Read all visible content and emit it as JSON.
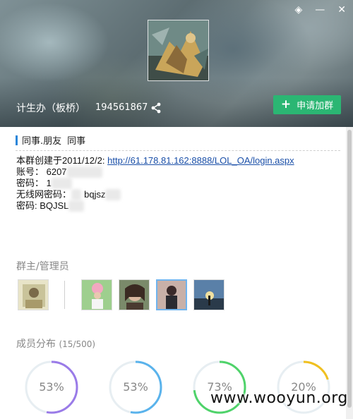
{
  "window": {
    "controls": [
      "◈",
      "—",
      "✕"
    ]
  },
  "header": {
    "group_name": "计生办（板桥）",
    "group_id": "194561867",
    "join_button": "申请加群"
  },
  "tags": [
    "同事.朋友",
    "同事"
  ],
  "description": {
    "line1_prefix": "本群创建于2011/12/2:",
    "line1_link": "http://61.178.81.162:8888/LOL_OA/login.aspx",
    "line2": "账号： 6207",
    "line3": "密码： 1",
    "line4": "无线网密码：",
    "line4_tail": "bqjsz",
    "line5": "密码: BQJSL"
  },
  "sections": {
    "admins_title": "群主/管理员",
    "members_title": "成员分布",
    "members_count": "(15/500)"
  },
  "stats": [
    {
      "label": "53%",
      "value": 0.53,
      "color": "#9a7be8"
    },
    {
      "label": "53%",
      "value": 0.53,
      "color": "#5ab3ec"
    },
    {
      "label": "73%",
      "value": 0.73,
      "color": "#4fd36a"
    },
    {
      "label": "20%",
      "value": 0.2,
      "color": "#f0c020"
    }
  ],
  "watermark": "www.wooyun.org"
}
